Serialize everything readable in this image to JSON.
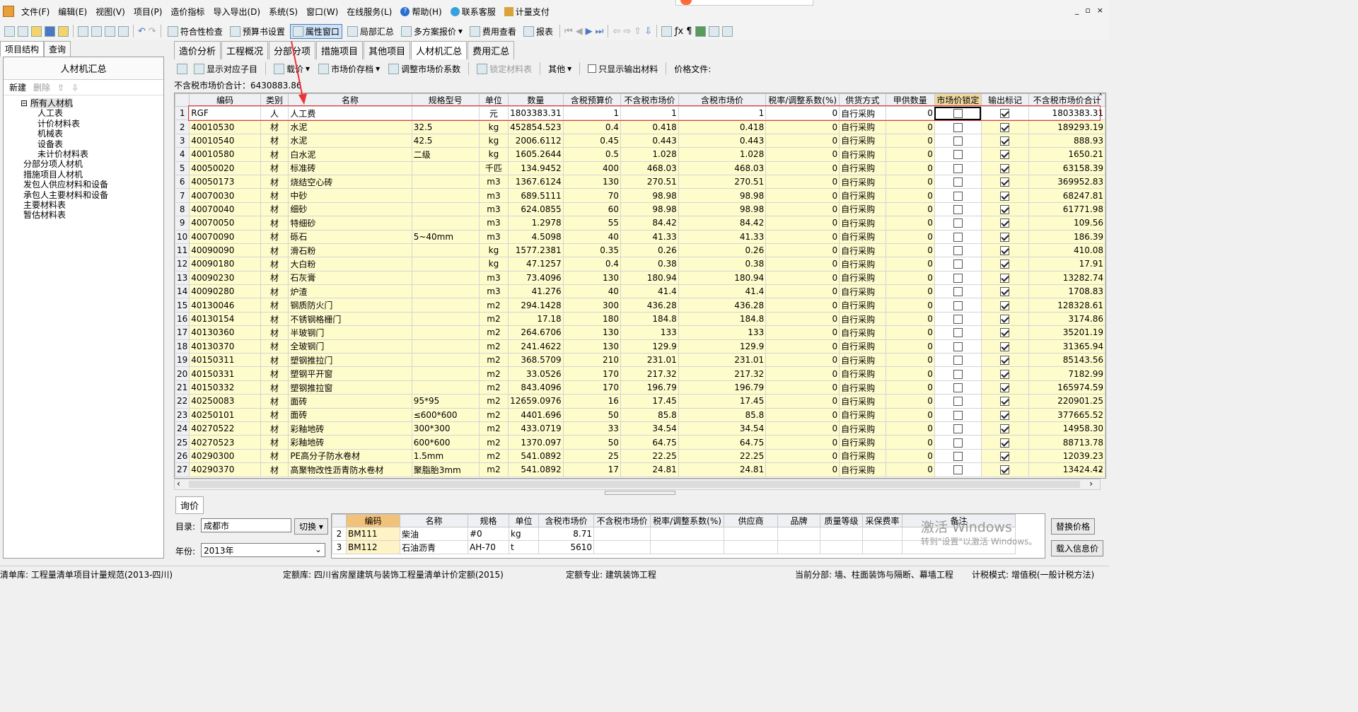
{
  "menu": [
    "文件(F)",
    "编辑(E)",
    "视图(V)",
    "项目(P)",
    "造价指标",
    "导入导出(D)",
    "系统(S)",
    "窗口(W)",
    "在线服务(L)",
    "帮助(H)",
    "联系客服",
    "计量支付"
  ],
  "window_controls": [
    "_",
    "▫",
    "×"
  ],
  "toolbar": {
    "compliance_check": "符合性检查",
    "budget_settings": "预算书设置",
    "property_window": "属性窗口",
    "local_summary": "局部汇总",
    "multi_plan": "多方案报价",
    "fee_view": "费用查看",
    "report": "报表"
  },
  "left": {
    "tabs": [
      "项目结构",
      "查询"
    ],
    "header": "人材机汇总",
    "actions": {
      "new": "新建",
      "delete": "删除"
    },
    "tree_root": "所有人材机",
    "tree_children": [
      "人工表",
      "计价材料表",
      "机械表",
      "设备表",
      "未计价材料表"
    ],
    "tree_top": [
      "分部分项人材机",
      "措施项目人材机",
      "发包人供应材料和设备",
      "承包人主要材料和设备",
      "主要材料表",
      "暂估材料表"
    ]
  },
  "main_tabs": [
    "造价分析",
    "工程概况",
    "分部分项",
    "措施项目",
    "其他项目",
    "人材机汇总",
    "费用汇总"
  ],
  "subtoolbar": {
    "show_items": "显示对应子目",
    "load_price": "载价",
    "market_archive": "市场价存档",
    "adjust_coef": "调整市场价系数",
    "lock_table": "锁定材料表",
    "other": "其他",
    "only_output": "只显示输出材料",
    "price_file": "价格文件:"
  },
  "total_label": "不含税市场价合计：6430883.86",
  "columns": [
    "",
    "编码",
    "类别",
    "名称",
    "规格型号",
    "单位",
    "数量",
    "含税预算价",
    "不含税市场价",
    "含税市场价",
    "税率/调整系数(%)",
    "供货方式",
    "甲供数量",
    "市场价锁定",
    "输出标记",
    "不含税市场价合计"
  ],
  "rows": [
    [
      "1",
      "RGF",
      "人",
      "人工费",
      "",
      "元",
      "1803383.31",
      "1",
      "1",
      "1",
      "0",
      "自行采购",
      "0",
      false,
      true,
      "1803383.31"
    ],
    [
      "2",
      "40010530",
      "材",
      "水泥",
      "32.5",
      "kg",
      "452854.523",
      "0.4",
      "0.418",
      "0.418",
      "0",
      "自行采购",
      "0",
      false,
      true,
      "189293.19"
    ],
    [
      "3",
      "40010540",
      "材",
      "水泥",
      "42.5",
      "kg",
      "2006.6112",
      "0.45",
      "0.443",
      "0.443",
      "0",
      "自行采购",
      "0",
      false,
      true,
      "888.93"
    ],
    [
      "4",
      "40010580",
      "材",
      "白水泥",
      "二级",
      "kg",
      "1605.2644",
      "0.5",
      "1.028",
      "1.028",
      "0",
      "自行采购",
      "0",
      false,
      true,
      "1650.21"
    ],
    [
      "5",
      "40050020",
      "材",
      "标准砖",
      "",
      "千匹",
      "134.9452",
      "400",
      "468.03",
      "468.03",
      "0",
      "自行采购",
      "0",
      false,
      true,
      "63158.39"
    ],
    [
      "6",
      "40050173",
      "材",
      "烧结空心砖",
      "",
      "m3",
      "1367.6124",
      "130",
      "270.51",
      "270.51",
      "0",
      "自行采购",
      "0",
      false,
      true,
      "369952.83"
    ],
    [
      "7",
      "40070030",
      "材",
      "中砂",
      "",
      "m3",
      "689.5111",
      "70",
      "98.98",
      "98.98",
      "0",
      "自行采购",
      "0",
      false,
      true,
      "68247.81"
    ],
    [
      "8",
      "40070040",
      "材",
      "细砂",
      "",
      "m3",
      "624.0855",
      "60",
      "98.98",
      "98.98",
      "0",
      "自行采购",
      "0",
      false,
      true,
      "61771.98"
    ],
    [
      "9",
      "40070050",
      "材",
      "特细砂",
      "",
      "m3",
      "1.2978",
      "55",
      "84.42",
      "84.42",
      "0",
      "自行采购",
      "0",
      false,
      true,
      "109.56"
    ],
    [
      "10",
      "40070090",
      "材",
      "砾石",
      "5~40mm",
      "m3",
      "4.5098",
      "40",
      "41.33",
      "41.33",
      "0",
      "自行采购",
      "0",
      false,
      true,
      "186.39"
    ],
    [
      "11",
      "40090090",
      "材",
      "滑石粉",
      "",
      "kg",
      "1577.2381",
      "0.35",
      "0.26",
      "0.26",
      "0",
      "自行采购",
      "0",
      false,
      true,
      "410.08"
    ],
    [
      "12",
      "40090180",
      "材",
      "大白粉",
      "",
      "kg",
      "47.1257",
      "0.4",
      "0.38",
      "0.38",
      "0",
      "自行采购",
      "0",
      false,
      true,
      "17.91"
    ],
    [
      "13",
      "40090230",
      "材",
      "石灰膏",
      "",
      "m3",
      "73.4096",
      "130",
      "180.94",
      "180.94",
      "0",
      "自行采购",
      "0",
      false,
      true,
      "13282.74"
    ],
    [
      "14",
      "40090280",
      "材",
      "炉渣",
      "",
      "m3",
      "41.276",
      "40",
      "41.4",
      "41.4",
      "0",
      "自行采购",
      "0",
      false,
      true,
      "1708.83"
    ],
    [
      "15",
      "40130046",
      "材",
      "钢质防火门",
      "",
      "m2",
      "294.1428",
      "300",
      "436.28",
      "436.28",
      "0",
      "自行采购",
      "0",
      false,
      true,
      "128328.61"
    ],
    [
      "16",
      "40130154",
      "材",
      "不锈钢格栅门",
      "",
      "m2",
      "17.18",
      "180",
      "184.8",
      "184.8",
      "0",
      "自行采购",
      "0",
      false,
      true,
      "3174.86"
    ],
    [
      "17",
      "40130360",
      "材",
      "半玻钢门",
      "",
      "m2",
      "264.6706",
      "130",
      "133",
      "133",
      "0",
      "自行采购",
      "0",
      false,
      true,
      "35201.19"
    ],
    [
      "18",
      "40130370",
      "材",
      "全玻钢门",
      "",
      "m2",
      "241.4622",
      "130",
      "129.9",
      "129.9",
      "0",
      "自行采购",
      "0",
      false,
      true,
      "31365.94"
    ],
    [
      "19",
      "40150311",
      "材",
      "塑钢推拉门",
      "",
      "m2",
      "368.5709",
      "210",
      "231.01",
      "231.01",
      "0",
      "自行采购",
      "0",
      false,
      true,
      "85143.56"
    ],
    [
      "20",
      "40150331",
      "材",
      "塑钢平开窗",
      "",
      "m2",
      "33.0526",
      "170",
      "217.32",
      "217.32",
      "0",
      "自行采购",
      "0",
      false,
      true,
      "7182.99"
    ],
    [
      "21",
      "40150332",
      "材",
      "塑钢推拉窗",
      "",
      "m2",
      "843.4096",
      "170",
      "196.79",
      "196.79",
      "0",
      "自行采购",
      "0",
      false,
      true,
      "165974.59"
    ],
    [
      "22",
      "40250083",
      "材",
      "面砖",
      "95*95",
      "m2",
      "12659.0976",
      "16",
      "17.45",
      "17.45",
      "0",
      "自行采购",
      "0",
      false,
      true,
      "220901.25"
    ],
    [
      "23",
      "40250101",
      "材",
      "面砖",
      "≤600*600",
      "m2",
      "4401.696",
      "50",
      "85.8",
      "85.8",
      "0",
      "自行采购",
      "0",
      false,
      true,
      "377665.52"
    ],
    [
      "24",
      "40270522",
      "材",
      "彩釉地砖",
      "300*300",
      "m2",
      "433.0719",
      "33",
      "34.54",
      "34.54",
      "0",
      "自行采购",
      "0",
      false,
      true,
      "14958.30"
    ],
    [
      "25",
      "40270523",
      "材",
      "彩釉地砖",
      "600*600",
      "m2",
      "1370.097",
      "50",
      "64.75",
      "64.75",
      "0",
      "自行采购",
      "0",
      false,
      true,
      "88713.78"
    ],
    [
      "26",
      "40290300",
      "材",
      "PE高分子防水卷材",
      "1.5mm",
      "m2",
      "541.0892",
      "25",
      "22.25",
      "22.25",
      "0",
      "自行采购",
      "0",
      false,
      true,
      "12039.23"
    ],
    [
      "27",
      "40290370",
      "材",
      "高聚物改性沥青防水卷材",
      "聚脂胎3mm",
      "m2",
      "541.0892",
      "17",
      "24.81",
      "24.81",
      "0",
      "自行采购",
      "0",
      false,
      true,
      "13424.42"
    ]
  ],
  "bottom": {
    "tab": "询价",
    "catalog_label": "目录:",
    "catalog_value": "成都市",
    "switch": "切换",
    "year_label": "年份:",
    "year_value": "2013年",
    "columns": [
      "",
      "编码",
      "名称",
      "规格",
      "单位",
      "含税市场价",
      "不含税市场价",
      "税率/调整系数(%)",
      "供应商",
      "品牌",
      "质量等级",
      "采保费率",
      "备注"
    ],
    "rows": [
      [
        "2",
        "BM111",
        "柴油",
        "#0",
        "kg",
        "8.71",
        "",
        "",
        "",
        "",
        "",
        "",
        ""
      ],
      [
        "3",
        "BM112",
        "石油沥青",
        "AH-70",
        "t",
        "5610",
        "",
        "",
        "",
        "",
        "",
        "",
        ""
      ]
    ],
    "replace_price": "替换价格",
    "load_info": "载入信息价"
  },
  "watermark": {
    "line1": "激活 Windows",
    "line2": "转到\"设置\"以激活 Windows。"
  },
  "status": {
    "list_lib": "清单库:  工程量清单项目计量规范(2013-四川)",
    "quota_lib": "定额库:  四川省房屋建筑与装饰工程量清单计价定额(2015)",
    "quota_major": "定额专业:  建筑装饰工程",
    "current_part": "当前分部:  墙、柱面装饰与隔断、幕墙工程",
    "tax_mode": "计税模式:  增值税(一般计税方法)"
  },
  "colors": {
    "row_yellow": "#fffccc",
    "lock_header": "#f0d9a0",
    "highlight_red": "#e33333"
  }
}
